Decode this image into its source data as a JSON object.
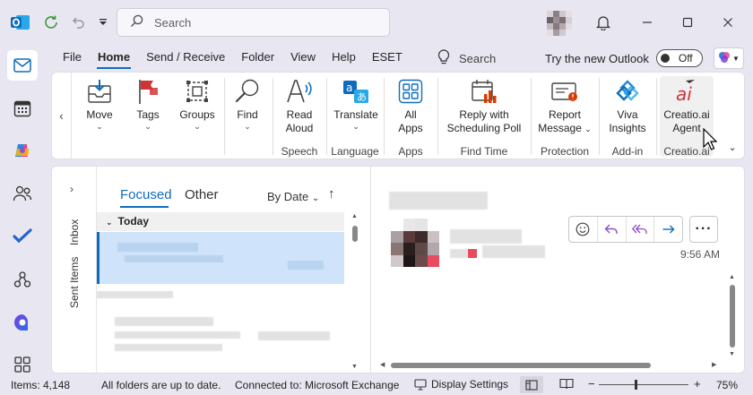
{
  "titlebar": {
    "search_placeholder": "Search",
    "icons": [
      "outlook-logo-icon",
      "sync-icon",
      "undo-icon",
      "customize-qat-icon",
      "bell-icon",
      "minimize-icon",
      "maximize-icon",
      "close-icon"
    ]
  },
  "menu": {
    "tabs": [
      "File",
      "Home",
      "Send / Receive",
      "Folder",
      "View",
      "Help",
      "ESET"
    ],
    "active_tab": "Home",
    "search_label": "Search",
    "try_new_label": "Try the new Outlook",
    "toggle_label": "Off"
  },
  "ribbon": {
    "move": {
      "label": "Move"
    },
    "tags": {
      "label": "Tags"
    },
    "groups": {
      "label": "Groups"
    },
    "find": {
      "label": "Find"
    },
    "read_aloud": {
      "label1": "Read",
      "label2": "Aloud"
    },
    "translate": {
      "label": "Translate"
    },
    "all_apps": {
      "label1": "All",
      "label2": "Apps"
    },
    "reply_sched": {
      "label1": "Reply with",
      "label2": "Scheduling Poll"
    },
    "report": {
      "label1": "Report",
      "label2": "Message"
    },
    "viva": {
      "label1": "Viva",
      "label2": "Insights"
    },
    "creatio": {
      "label1": "Creatio.ai",
      "label2": "Agent"
    },
    "groups_labels": {
      "speech": "Speech",
      "language": "Language",
      "apps": "Apps",
      "find_time": "Find Time",
      "protection": "Protection",
      "addin": "Add-in",
      "creatio": "Creatio.ai"
    }
  },
  "folders": {
    "inbox": "Inbox",
    "sent": "Sent Items"
  },
  "list": {
    "tab_focused": "Focused",
    "tab_other": "Other",
    "sort_label": "By Date",
    "group_header": "Today"
  },
  "reading": {
    "time": "9:56 AM"
  },
  "status": {
    "items": "Items: 4,148",
    "sync": "All folders are up to date.",
    "connection": "Connected to: Microsoft Exchange",
    "display_settings": "Display Settings",
    "zoom": "75%"
  },
  "colors": {
    "accent": "#0f6cbd",
    "selected_row": "#cfe4fa",
    "reply_purple": "#8e4ec6"
  }
}
